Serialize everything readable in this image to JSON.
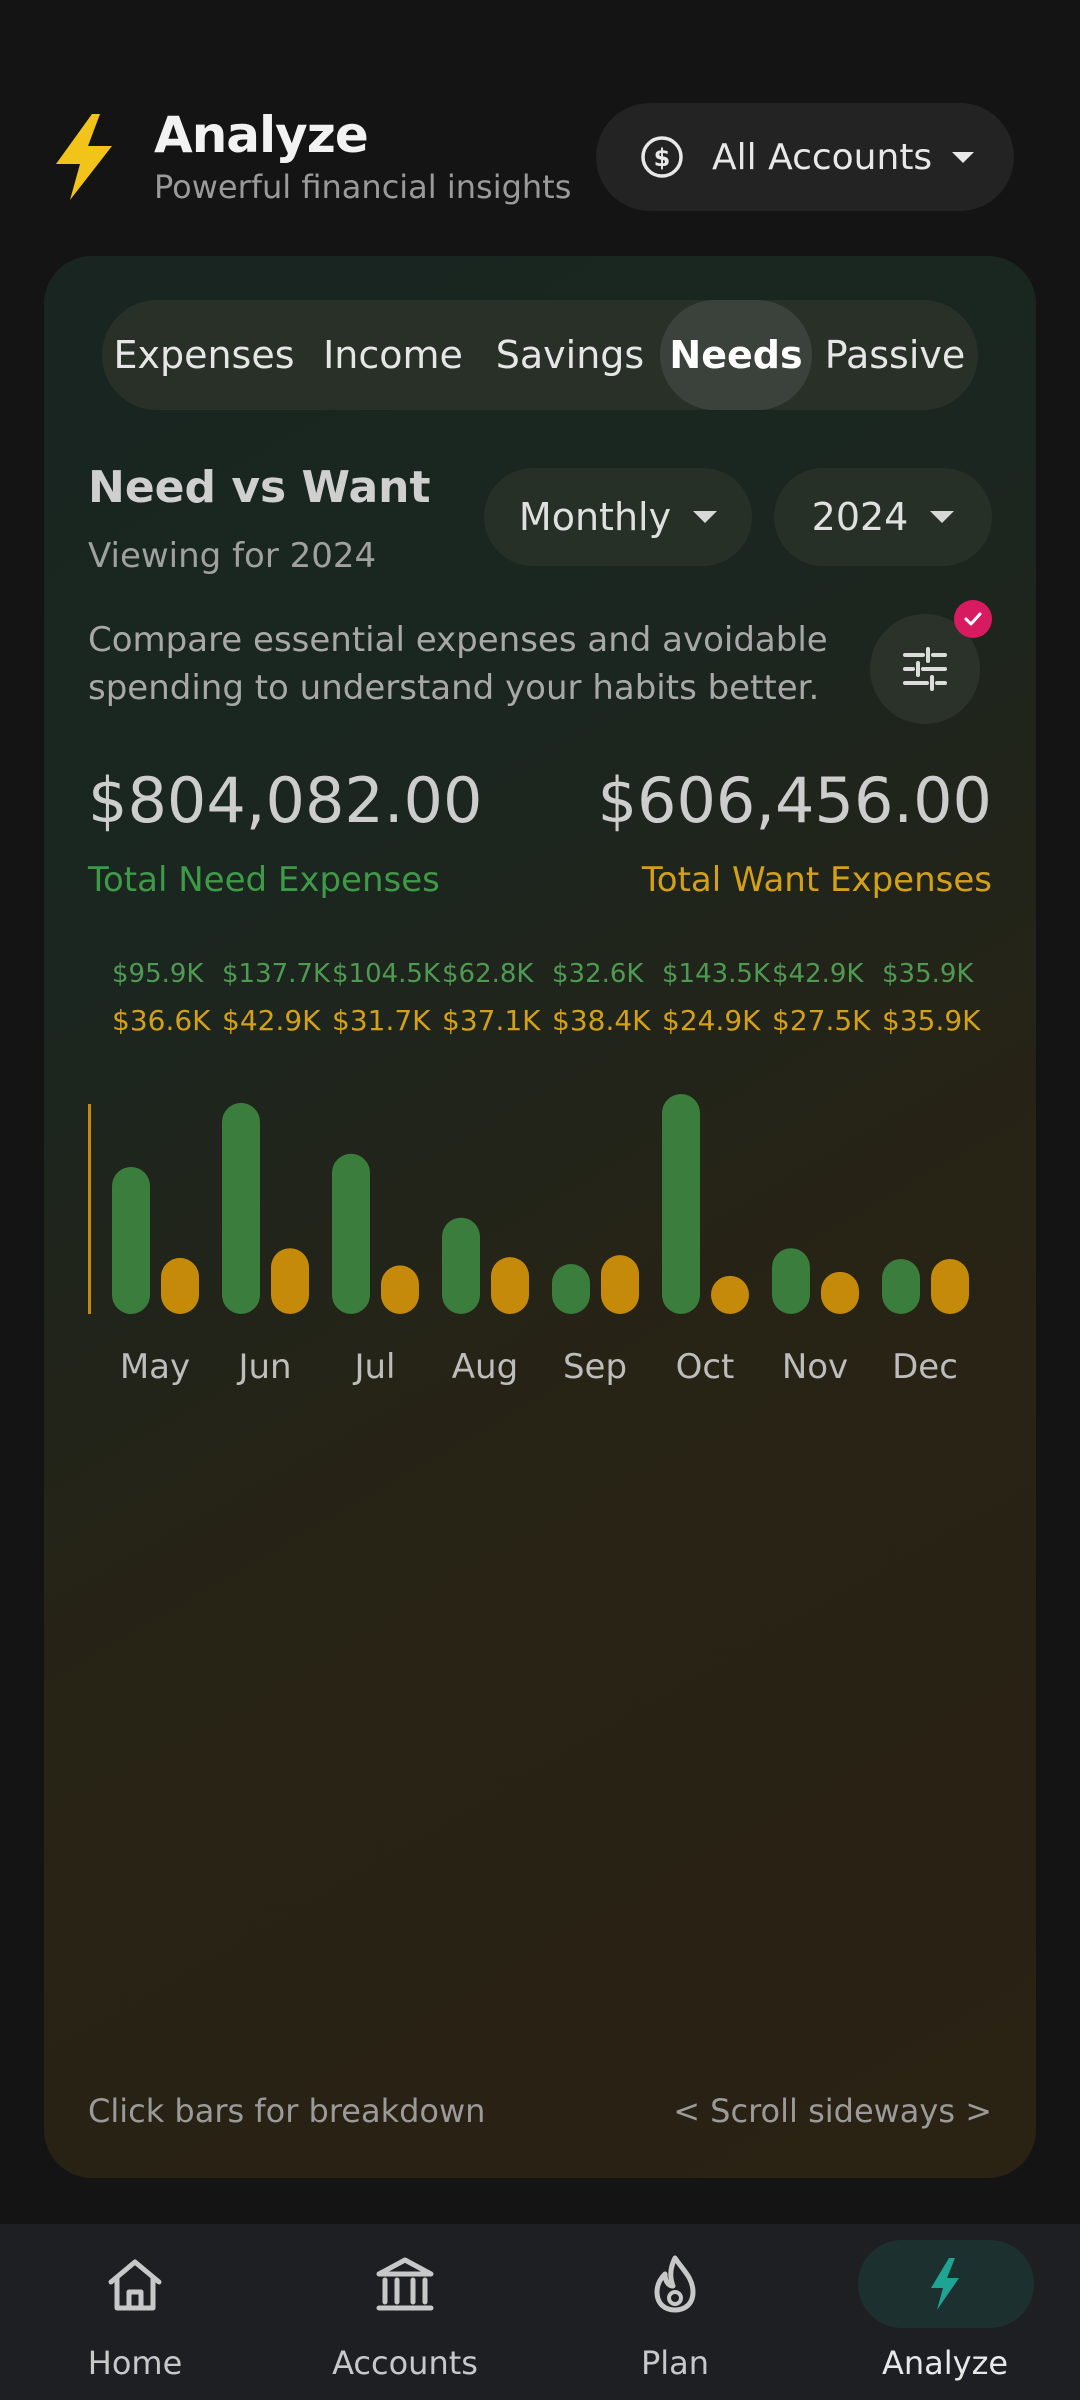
{
  "header": {
    "title": "Analyze",
    "subtitle": "Powerful financial insights",
    "bolt_icon": "lightning-bolt-icon",
    "account_selector": {
      "label": "All Accounts",
      "icon": "dollar-circle-icon"
    }
  },
  "tabs": [
    {
      "label": "Expenses",
      "active": false
    },
    {
      "label": "Income",
      "active": false
    },
    {
      "label": "Savings",
      "active": false
    },
    {
      "label": "Needs",
      "active": true
    },
    {
      "label": "Passive",
      "active": false
    }
  ],
  "section": {
    "title": "Need vs Want",
    "subtitle": "Viewing for 2024",
    "period_dropdown": "Monthly",
    "year_dropdown": "2024",
    "description": "Compare essential expenses and avoidable spending to understand your habits better.",
    "filter_icon": "sliders-icon"
  },
  "totals": {
    "need_amount": "$804,082.00",
    "need_label": "Total Need Expenses",
    "want_amount": "$606,456.00",
    "want_label": "Total Want Expenses"
  },
  "colors": {
    "need": "#3a7d3c",
    "want": "#c68a0b",
    "need_text": "#3f9a48",
    "want_text": "#d4a017",
    "badge": "#d81b60"
  },
  "chart_data": {
    "type": "bar",
    "categories": [
      "May",
      "Jun",
      "Jul",
      "Aug",
      "Sep",
      "Oct",
      "Nov",
      "Dec"
    ],
    "series": [
      {
        "name": "Need",
        "values": [
          95.9,
          137.7,
          104.5,
          62.8,
          32.6,
          143.5,
          42.9,
          35.9
        ],
        "labels": [
          "$95.9K",
          "$137.7K",
          "$104.5K",
          "$62.8K",
          "$32.6K",
          "$143.5K",
          "$42.9K",
          "$35.9K"
        ]
      },
      {
        "name": "Want",
        "values": [
          36.6,
          42.9,
          31.7,
          37.1,
          38.4,
          24.9,
          27.5,
          35.9
        ],
        "labels": [
          "$36.6K",
          "$42.9K",
          "$31.7K",
          "$37.1K",
          "$38.4K",
          "$24.9K",
          "$27.5K",
          "$35.9K"
        ]
      }
    ],
    "ymax": 143.5,
    "scroll_hint": true
  },
  "chart_hints": {
    "left": "Click bars for breakdown",
    "right": "< Scroll sideways >"
  },
  "nav": [
    {
      "label": "Home",
      "icon": "home-icon",
      "active": false
    },
    {
      "label": "Accounts",
      "icon": "bank-icon",
      "active": false
    },
    {
      "label": "Plan",
      "icon": "flame-icon",
      "active": false
    },
    {
      "label": "Analyze",
      "icon": "lightning-bolt-icon",
      "active": true
    }
  ]
}
